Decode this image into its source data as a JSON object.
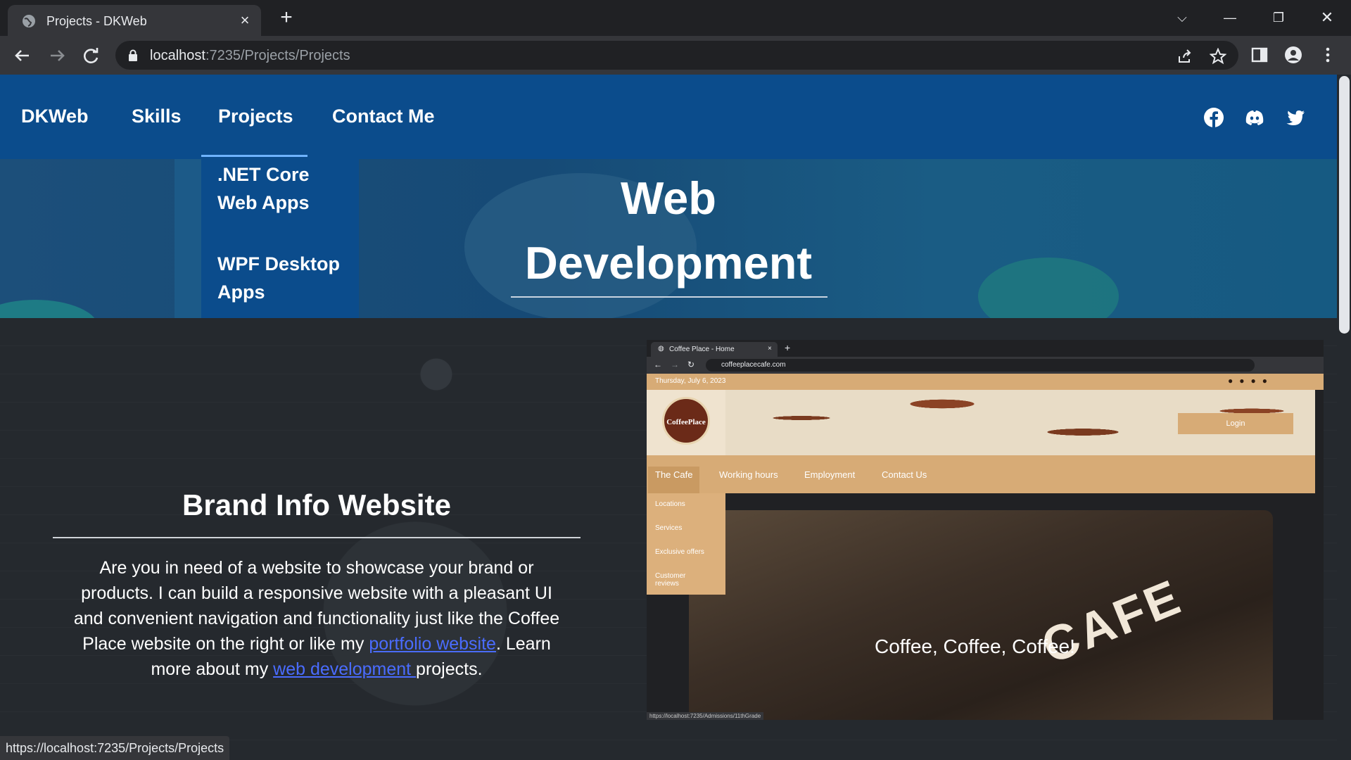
{
  "browser": {
    "tab_title": "Projects - DKWeb",
    "url_host": "localhost",
    "url_rest": ":7235/Projects/Projects",
    "status_url": "https://localhost:7235/Projects/Projects"
  },
  "site": {
    "brand": "DKWeb",
    "nav": [
      "Skills",
      "Projects",
      "Contact Me"
    ],
    "dropdown": [
      ".NET Core Web Apps",
      "WPF Desktop Apps"
    ],
    "social_icons": [
      "facebook-icon",
      "discord-icon",
      "twitter-icon"
    ],
    "accent_color": "#0b4c8c"
  },
  "hero": {
    "title_line1": "Web",
    "title_line2": "Development"
  },
  "section": {
    "title": "Brand Info Website",
    "body_1": "Are you in need of a website to showcase your brand or products. I can build a responsive website with a pleasant UI and convenient navigation and functionality just like the Coffee Place website on the right or like my ",
    "link_portfolio": "portfolio website",
    "body_2": ". Learn more about my ",
    "link_webdev": "web development ",
    "body_3": "projects."
  },
  "screenshot": {
    "tab_title": "Coffee Place - Home",
    "url": "coffeeplacecafe.com",
    "date": "Thursday, July 6, 2023",
    "logo_text": "CoffeePlace",
    "login": "Login",
    "menu": [
      "The Cafe",
      "Working hours",
      "Employment",
      "Contact Us"
    ],
    "submenu": [
      "Locations",
      "Services",
      "Exclusive offers",
      "Customer reviews"
    ],
    "slogan": "Coffee, Coffee, Coffee!",
    "sign": "CAFE",
    "status_url": "https://localhost:7235/Admissions/11thGrade"
  }
}
